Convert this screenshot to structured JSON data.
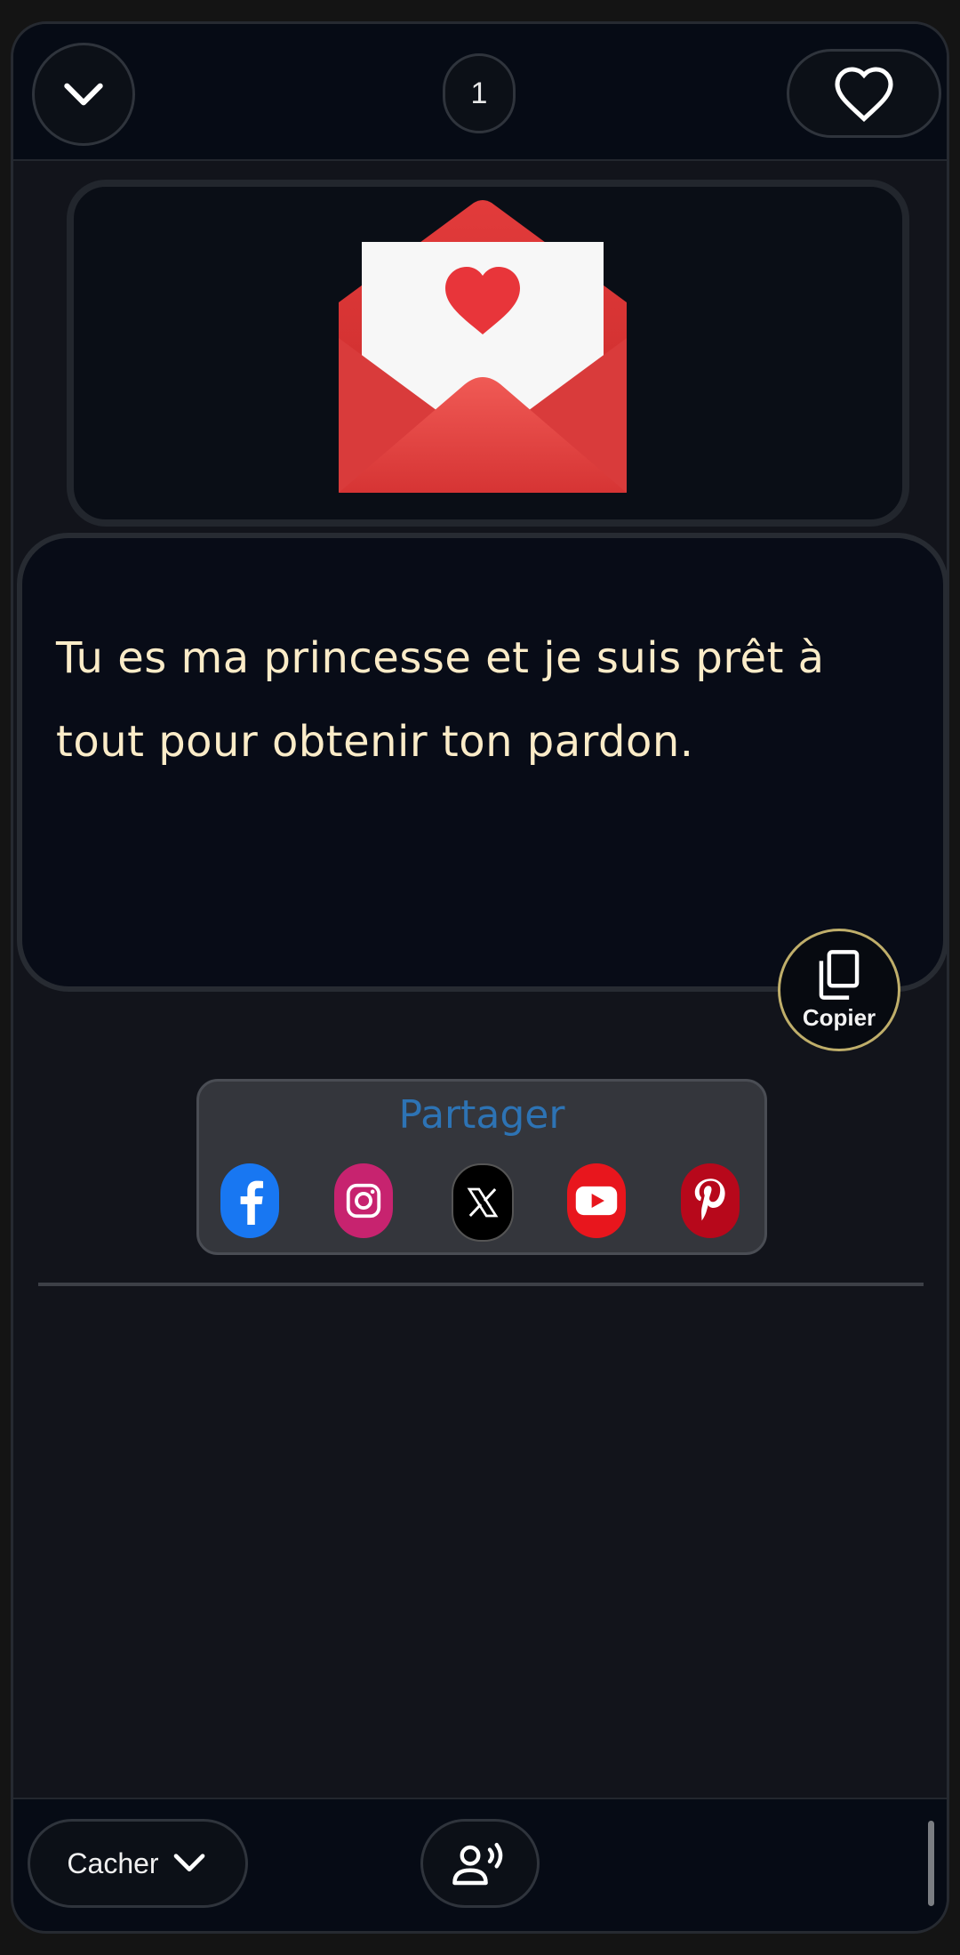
{
  "header": {
    "count": "1"
  },
  "message": {
    "text": "Tu es ma princesse et je suis prêt à tout pour obtenir ton pardon.",
    "emoji": "love-letter-icon"
  },
  "copy": {
    "label": "Copier"
  },
  "share": {
    "title": "Partager",
    "networks": [
      "facebook-icon",
      "instagram-icon",
      "x-icon",
      "youtube-icon",
      "pinterest-icon"
    ]
  },
  "footer": {
    "hide_label": "Cacher"
  },
  "colors": {
    "message_text": "#fbecc8",
    "share_title": "#2d73b4",
    "copy_border": "#bfae6a"
  }
}
